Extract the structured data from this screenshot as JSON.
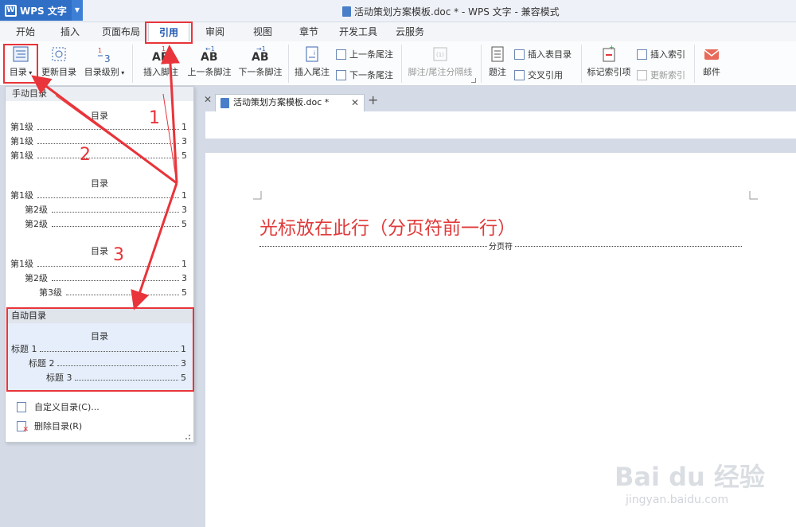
{
  "app": {
    "name": "WPS 文字",
    "window_title": "活动策划方案模板.doc * - WPS 文字 - 兼容模式"
  },
  "menu_tabs": [
    "开始",
    "插入",
    "页面布局",
    "引用",
    "审阅",
    "视图",
    "章节",
    "开发工具",
    "云服务"
  ],
  "active_tab": "引用",
  "ribbon": {
    "toc": "目录",
    "update_toc": "更新目录",
    "toc_level": "目录级别",
    "insert_footnote": "插入脚注",
    "prev_footnote": "上一条脚注",
    "next_footnote": "下一条脚注",
    "insert_endnote": "插入尾注",
    "prev_endnote": "上一条尾注",
    "next_endnote": "下一条尾注",
    "separator": "脚注/尾注分隔线",
    "caption": "题注",
    "insert_figure_table": "插入表目录",
    "cross_ref": "交叉引用",
    "mark_index": "标记索引项",
    "insert_index": "插入索引",
    "update_index": "更新索引",
    "mail": "邮件"
  },
  "doc_tab": {
    "label": "活动策划方案模板.doc *"
  },
  "document": {
    "heading": "光标放在此行（分页符前一行）",
    "page_break": "分页符"
  },
  "dropdown": {
    "manual_header": "手动目录",
    "blocks": [
      {
        "title": "目录",
        "lines": [
          {
            "label": "第1级",
            "page": "1",
            "level": 0
          },
          {
            "label": "第1级",
            "page": "3",
            "level": 0
          },
          {
            "label": "第1级",
            "page": "5",
            "level": 0
          }
        ]
      },
      {
        "title": "目录",
        "lines": [
          {
            "label": "第1级",
            "page": "1",
            "level": 0
          },
          {
            "label": "第2级",
            "page": "3",
            "level": 1
          },
          {
            "label": "第2级",
            "page": "5",
            "level": 1
          }
        ]
      },
      {
        "title": "目录",
        "lines": [
          {
            "label": "第1级",
            "page": "1",
            "level": 0
          },
          {
            "label": "第2级",
            "page": "3",
            "level": 1
          },
          {
            "label": "第3级",
            "page": "5",
            "level": 2
          }
        ]
      }
    ],
    "auto_header": "自动目录",
    "auto_block": {
      "title": "目录",
      "lines": [
        {
          "label": "标题 1",
          "page": "1",
          "level": 0
        },
        {
          "label": "标题 2",
          "page": "3",
          "level": 1
        },
        {
          "label": "标题 3",
          "page": "5",
          "level": 2
        }
      ]
    },
    "custom": "自定义目录(C)...",
    "delete": "删除目录(R)"
  },
  "annotations": [
    "1",
    "2",
    "3"
  ],
  "watermark": {
    "brand": "Bai du 经验",
    "url": "jingyan.baidu.com"
  },
  "colors": {
    "accent": "#2f6fc6",
    "highlight": "#e8343a",
    "heading": "#e03a3a"
  }
}
